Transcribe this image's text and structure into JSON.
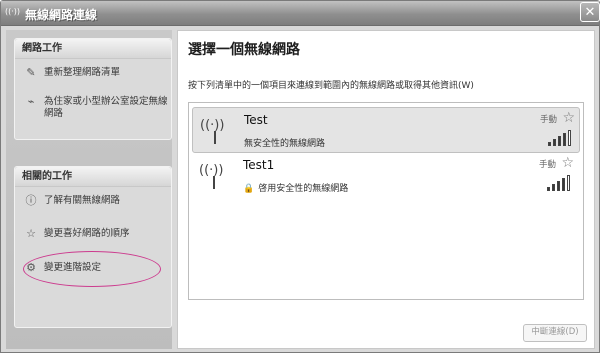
{
  "window": {
    "title": "無線網路連線",
    "close_icon": "close-icon"
  },
  "sidebar": {
    "network_tasks": {
      "title": "網路工作",
      "items": [
        {
          "label": "重新整理網路清單",
          "icon": "refresh-icon"
        },
        {
          "label": "為住家或小型辦公室設定無線網路",
          "icon": "setup-icon"
        }
      ]
    },
    "related_tasks": {
      "title": "相關的工作",
      "items": [
        {
          "label": "了解有關無線網路",
          "icon": "info-icon"
        },
        {
          "label": "變更喜好網路的順序",
          "icon": "star-icon"
        },
        {
          "label": "變更進階設定",
          "icon": "settings-icon"
        }
      ]
    }
  },
  "main": {
    "heading": "選擇一個無線網路",
    "instruction": "按下列清單中的一個項目來連線到範圍內的無線網路或取得其他資訊(W)",
    "networks": [
      {
        "name": "Test",
        "mode": "手動",
        "security": "無安全性的無線網路",
        "signal": 0.8,
        "selected": true
      },
      {
        "name": "Test1",
        "mode": "手動",
        "security": "啓用安全性的無線網路",
        "signal": 0.8,
        "selected": false
      }
    ],
    "connect_label": "中斷連線(D)"
  }
}
